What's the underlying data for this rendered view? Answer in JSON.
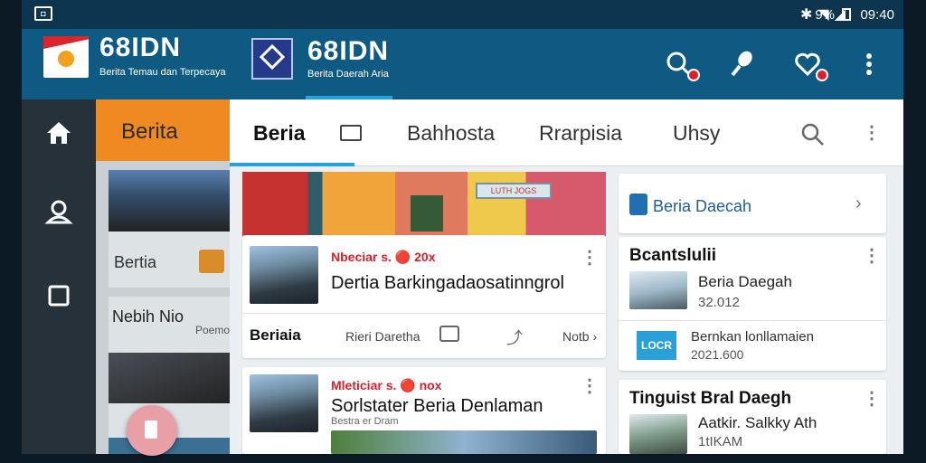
{
  "status_bar": {
    "notification_icon": "notification-icon",
    "icons": [
      "bluetooth-icon",
      "wifi-icon",
      "signal-icon"
    ],
    "battery": "9%",
    "time": "09:40"
  },
  "app_bar": {
    "brand_left": {
      "title": "68IDN",
      "subtitle": "Berita Temau dan Terpecaya"
    },
    "brand_right": {
      "title": "68IDN",
      "subtitle": "Berita Daerah Aria"
    },
    "actions": [
      "search-icon",
      "mic-icon",
      "favorite-icon",
      "more-icon"
    ]
  },
  "rail": {
    "items": [
      "home-icon",
      "profile-icon",
      "square-icon"
    ]
  },
  "background_column": {
    "header": "Berita",
    "card1_label": "Bertia",
    "card2_title": "Nebih Nio",
    "card2_sub": "Poemo"
  },
  "tabs": {
    "items": [
      {
        "label": "Beria"
      },
      {
        "label": "Bahhosta"
      },
      {
        "label": "Rrarpisia"
      },
      {
        "label": "Uhsy"
      }
    ],
    "active": "Beria"
  },
  "feed": [
    {
      "kicker": "Nbeciar s. 🔴 20x",
      "headline": "Dertia Barkingadaosatinngrol",
      "source": "Beriaia",
      "meta": "Rieri Daretha",
      "more": "Notb"
    },
    {
      "kicker": "Mleticiar s. 🔴 nox",
      "headline": "Sorlstater Beria Denlaman",
      "subline": "Bestra er Dram"
    }
  ],
  "building_sign": "LUTH JOGS",
  "sidebar": {
    "top_card": {
      "label": "Beria Daecah"
    },
    "section1": {
      "title": "Bcantslulii",
      "item_title": "Beria Daegah",
      "item_time": "32.012",
      "item2_badge": "LOCR",
      "item2_title": "Bernkan lonllamaien",
      "item2_time": "2021.600"
    },
    "section2": {
      "title": "Tinguist Bral Daegh",
      "item_title": "Aatkir. Salkky Ath",
      "item_time": "1tIKAM"
    }
  },
  "colors": {
    "appbar": "#0f5a83",
    "accent": "#22a3df",
    "orange": "#ee8a21",
    "red": "#e11d2a"
  }
}
